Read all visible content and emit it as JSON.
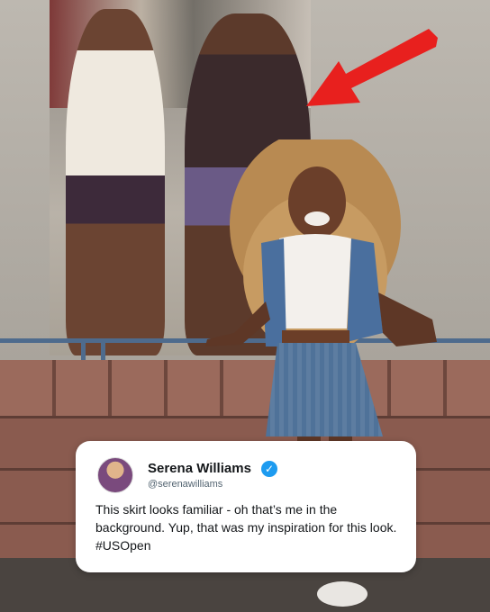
{
  "tweet": {
    "display_name": "Serena Williams",
    "handle": "@serenawilliams",
    "verified": true,
    "text": "This skirt looks familiar - oh that’s me in the background. Yup, that was my inspiration for this look. #USOpen"
  },
  "colors": {
    "arrow": "#e8201e",
    "verified_badge": "#1d9bf0",
    "card_bg": "#ffffff",
    "denim": "#4a6f9e"
  },
  "icons": {
    "verified": "verified-badge-icon",
    "arrow": "red-arrow-pointer"
  }
}
